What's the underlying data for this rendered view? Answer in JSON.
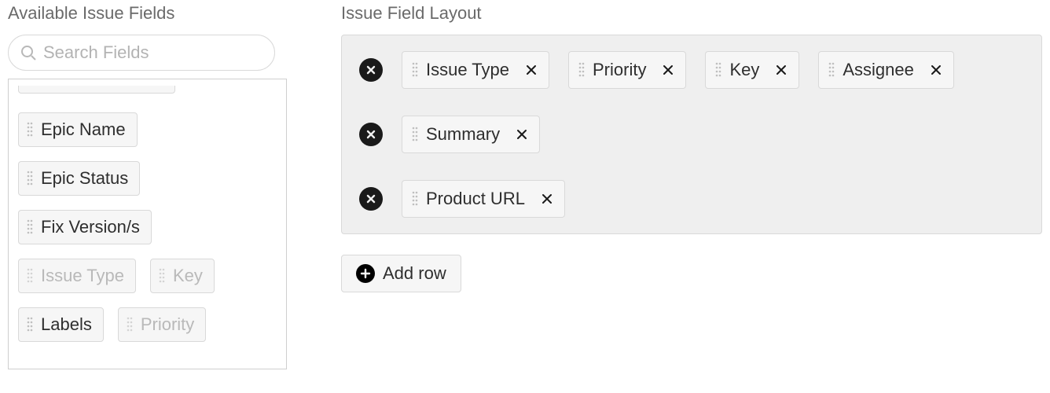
{
  "available": {
    "title": "Available Issue Fields",
    "search_placeholder": "Search Fields",
    "fields": [
      {
        "label": "Epic Name",
        "dim": false
      },
      {
        "label": "Epic Status",
        "dim": false
      },
      {
        "label": "Fix Version/s",
        "dim": false
      },
      {
        "label": "Issue Type",
        "dim": true
      },
      {
        "label": "Key",
        "dim": true
      },
      {
        "label": "Labels",
        "dim": false
      },
      {
        "label": "Priority",
        "dim": true
      }
    ]
  },
  "layout": {
    "title": "Issue Field Layout",
    "add_row_label": "Add row",
    "rows": [
      {
        "fields": [
          {
            "label": "Issue Type"
          },
          {
            "label": "Priority"
          },
          {
            "label": "Key"
          },
          {
            "label": "Assignee"
          }
        ]
      },
      {
        "fields": [
          {
            "label": "Summary"
          }
        ]
      },
      {
        "fields": [
          {
            "label": "Product URL"
          }
        ]
      }
    ]
  }
}
